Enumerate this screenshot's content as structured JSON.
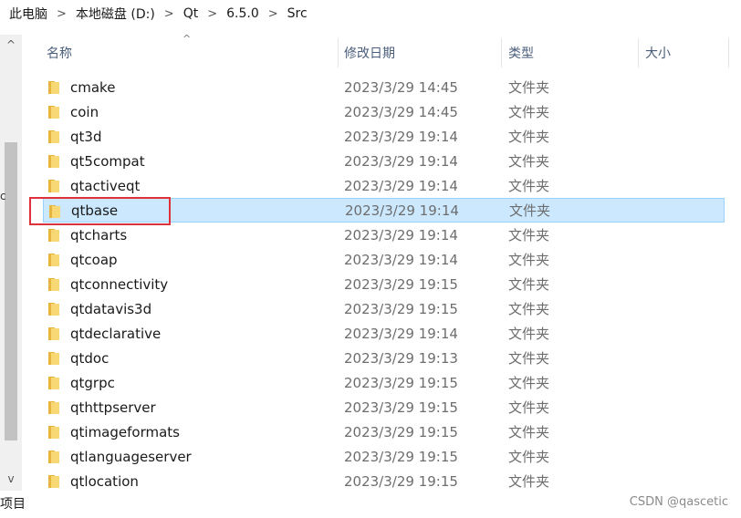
{
  "breadcrumb": [
    "此电脑",
    "本地磁盘 (D:)",
    "Qt",
    "6.5.0",
    "Src"
  ],
  "breadcrumb_separator": ">",
  "header": {
    "name": "名称",
    "modified": "修改日期",
    "type": "类型",
    "size": "大小"
  },
  "sort_indicator": "^",
  "scrollbar": {
    "up": "^",
    "down": "v"
  },
  "side_glyph": "c",
  "status": "项目",
  "watermark": "CSDN @qascetic",
  "selected_index": 5,
  "files": [
    {
      "name": "cmake",
      "date": "2023/3/29 14:45",
      "type": "文件夹"
    },
    {
      "name": "coin",
      "date": "2023/3/29 14:45",
      "type": "文件夹"
    },
    {
      "name": "qt3d",
      "date": "2023/3/29 19:14",
      "type": "文件夹"
    },
    {
      "name": "qt5compat",
      "date": "2023/3/29 19:14",
      "type": "文件夹"
    },
    {
      "name": "qtactiveqt",
      "date": "2023/3/29 19:14",
      "type": "文件夹"
    },
    {
      "name": "qtbase",
      "date": "2023/3/29 19:14",
      "type": "文件夹"
    },
    {
      "name": "qtcharts",
      "date": "2023/3/29 19:14",
      "type": "文件夹"
    },
    {
      "name": "qtcoap",
      "date": "2023/3/29 19:14",
      "type": "文件夹"
    },
    {
      "name": "qtconnectivity",
      "date": "2023/3/29 19:15",
      "type": "文件夹"
    },
    {
      "name": "qtdatavis3d",
      "date": "2023/3/29 19:15",
      "type": "文件夹"
    },
    {
      "name": "qtdeclarative",
      "date": "2023/3/29 19:14",
      "type": "文件夹"
    },
    {
      "name": "qtdoc",
      "date": "2023/3/29 19:13",
      "type": "文件夹"
    },
    {
      "name": "qtgrpc",
      "date": "2023/3/29 19:15",
      "type": "文件夹"
    },
    {
      "name": "qthttpserver",
      "date": "2023/3/29 19:15",
      "type": "文件夹"
    },
    {
      "name": "qtimageformats",
      "date": "2023/3/29 19:15",
      "type": "文件夹"
    },
    {
      "name": "qtlanguageserver",
      "date": "2023/3/29 19:15",
      "type": "文件夹"
    },
    {
      "name": "qtlocation",
      "date": "2023/3/29 19:15",
      "type": "文件夹"
    }
  ],
  "colors": {
    "selection_fill": "#cce8ff",
    "selection_border": "#99d1ff",
    "annotation_red": "#e0303c",
    "folder_yellow": "#f8d775"
  }
}
